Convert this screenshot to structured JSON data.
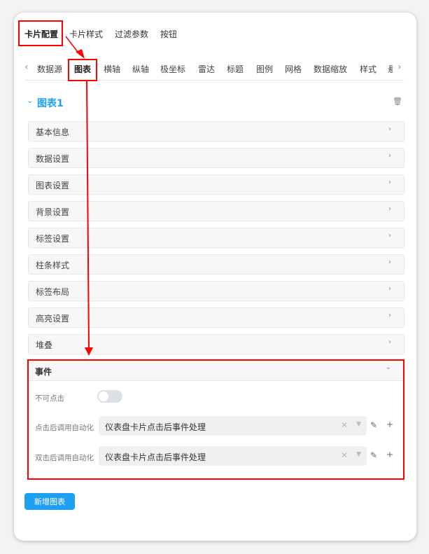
{
  "top_tabs": [
    "卡片配置",
    "卡片样式",
    "过滤参数",
    "按钮"
  ],
  "sub_tabs": [
    "数据源",
    "图表",
    "横轴",
    "纵轴",
    "极坐标",
    "雷达",
    "标题",
    "图例",
    "网格",
    "数据缩放",
    "样式",
    "悬"
  ],
  "chart": {
    "title": "图表1",
    "accent": "#1e9ff2"
  },
  "panels": [
    "基本信息",
    "数据设置",
    "图表设置",
    "背景设置",
    "标签设置",
    "柱条样式",
    "标签布局",
    "高亮设置",
    "堆叠"
  ],
  "event": {
    "title": "事件",
    "not_clickable_label": "不可点击",
    "not_clickable_on": false,
    "click_label": "点击后调用自动化",
    "click_value": "仪表盘卡片点击后事件处理",
    "dblclick_label": "双击后调用自动化",
    "dblclick_value": "仪表盘卡片点击后事件处理"
  },
  "add_chart_label": "新增图表",
  "annotation_color": "#ff0000"
}
